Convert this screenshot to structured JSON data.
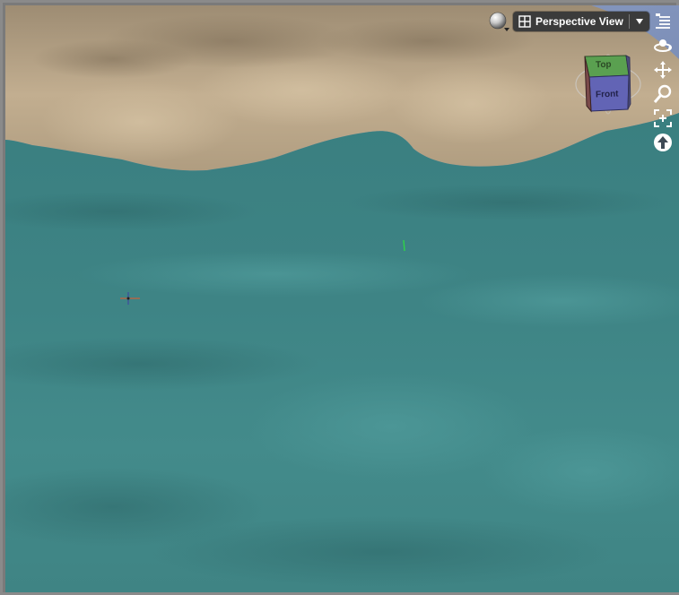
{
  "viewport": {
    "view_label": "Perspective View",
    "colors": {
      "sky": "#7f90b8",
      "sand": "#b9a688",
      "water": "#3f8585"
    }
  },
  "view_cube": {
    "top_label": "Top",
    "front_label": "Front"
  },
  "toolbar_icons": [
    "shading-sphere-icon",
    "grid-icon",
    "chevron-down-icon",
    "viewport-menu-icon",
    "orbit-icon",
    "pan-icon",
    "zoom-icon",
    "frame-icon",
    "up-arrow-icon"
  ]
}
